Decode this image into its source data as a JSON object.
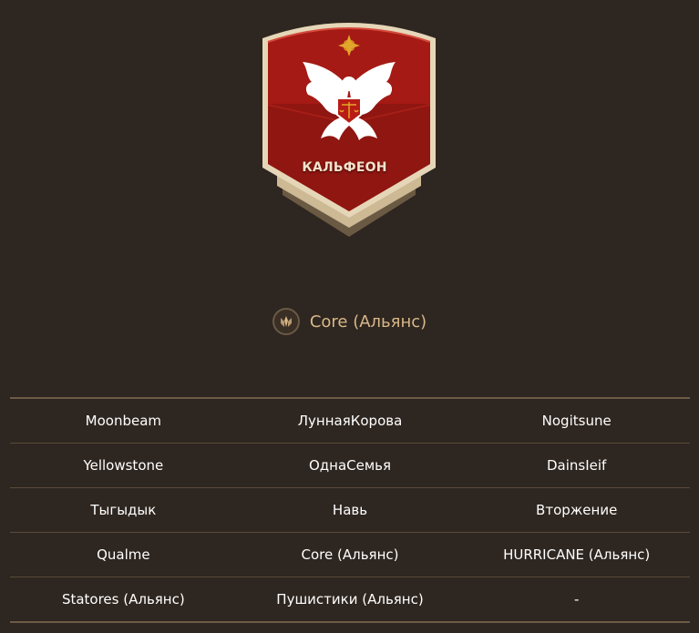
{
  "castle": {
    "name": "КАЛЬФЕОН",
    "colors": {
      "shield_red": "#a51a14",
      "shield_dark_red": "#7d0e0b",
      "frame_cream": "#e8d9bd",
      "frame_tan": "#c8b38d",
      "eagle_white": "#ffffff",
      "star_gold": "#e2a62a"
    }
  },
  "owner": {
    "icon": "guild-crest-icon",
    "name": "Core (Альянс)"
  },
  "clans": {
    "rows": [
      [
        "Moonbeam",
        "ЛуннаяКорова",
        "Nogitsune"
      ],
      [
        "Yellowstone",
        "ОднаСемья",
        "DainsIeif"
      ],
      [
        "Тыгыдык",
        "Навь",
        "Вторжение"
      ],
      [
        "Qualme",
        "Core (Альянс)",
        "HURRICANE (Альянс)"
      ],
      [
        "Statores (Альянс)",
        "Пушистики (Альянс)",
        "-"
      ]
    ]
  }
}
